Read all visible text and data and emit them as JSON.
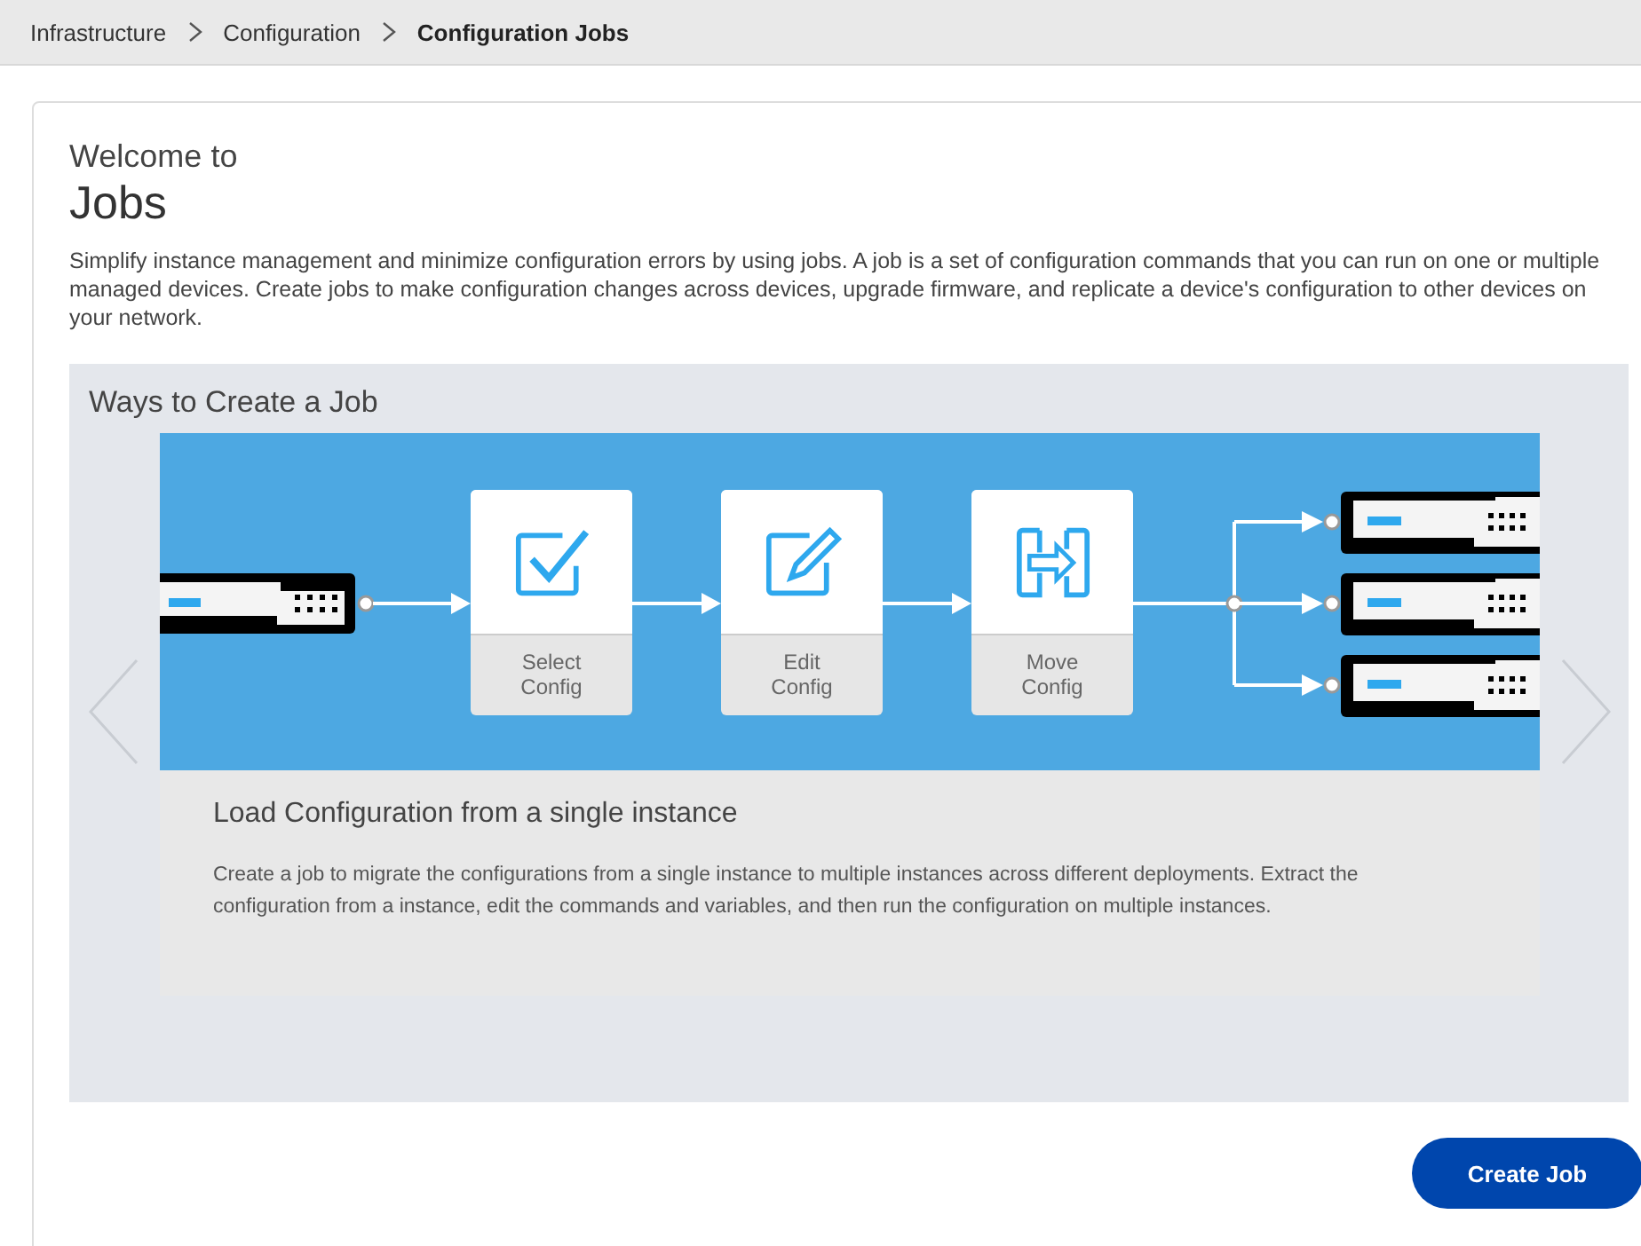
{
  "breadcrumb": [
    {
      "label": "Infrastructure",
      "current": false
    },
    {
      "label": "Configuration",
      "current": false
    },
    {
      "label": "Configuration Jobs",
      "current": true
    }
  ],
  "welcome": {
    "kicker": "Welcome to",
    "title": "Jobs",
    "description": "Simplify instance management and minimize configuration errors by using jobs. A job is a set of configuration commands that you can run on one or multiple managed devices. Create jobs to make configuration changes across devices, upgrade firmware, and replicate a device's configuration to other devices on your network."
  },
  "carousel": {
    "title": "Ways to Create a Job",
    "steps": [
      {
        "kind": "select",
        "label": "Select Config"
      },
      {
        "kind": "edit",
        "label": "Edit Config"
      },
      {
        "kind": "move",
        "label": "Move Config"
      }
    ],
    "slide_title": "Load Configuration from a single instance",
    "slide_text": "Create a job to migrate the configurations from a single instance to multiple instances across different deployments. Extract the configuration from a instance, edit the commands and variables, and then run the configuration on multiple instances."
  },
  "primary_button": "Create Job"
}
